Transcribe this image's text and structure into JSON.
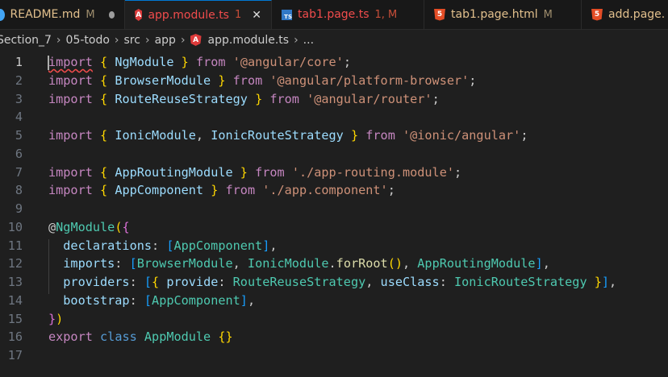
{
  "tabs": [
    {
      "label": "README.md",
      "badge": "M",
      "icon": "markdown-icon",
      "color": "#e2c08d",
      "badge_color": "#9e8d6d",
      "dot": true
    },
    {
      "label": "app.module.ts",
      "badge": "1",
      "icon": "angular-icon",
      "color": "#f14c4c",
      "badge_color": "#c74e39",
      "active": true
    },
    {
      "label": "tab1.page.ts",
      "badge": "1, M",
      "icon": "typescript-icon",
      "color": "#f14c4c",
      "badge_color": "#c74e39",
      "icon_text": "TS"
    },
    {
      "label": "tab1.page.html",
      "badge": "M",
      "icon": "html-icon",
      "color": "#e2c08d",
      "badge_color": "#9e8d6d",
      "icon_text": "5"
    },
    {
      "label": "add.page.",
      "badge": "",
      "icon": "html-icon",
      "color": "#e2c08d",
      "badge_color": "#9e8d6d",
      "icon_text": "5"
    }
  ],
  "breadcrumb": [
    "Section_7",
    "05-todo",
    "src",
    "app",
    "app.module.ts",
    "..."
  ],
  "lines": [
    [
      [
        "import",
        "kw"
      ],
      [
        " ",
        ""
      ],
      [
        "{",
        "br1"
      ],
      [
        " NgModule ",
        "id"
      ],
      [
        "}",
        "br1"
      ],
      [
        " ",
        ""
      ],
      [
        "from",
        "kw"
      ],
      [
        " ",
        ""
      ],
      [
        "'@angular/core'",
        "str"
      ],
      [
        ";",
        "pun"
      ]
    ],
    [
      [
        "import",
        "kw"
      ],
      [
        " ",
        ""
      ],
      [
        "{",
        "br1"
      ],
      [
        " BrowserModule ",
        "id"
      ],
      [
        "}",
        "br1"
      ],
      [
        " ",
        ""
      ],
      [
        "from",
        "kw"
      ],
      [
        " ",
        ""
      ],
      [
        "'@angular/platform-browser'",
        "str"
      ],
      [
        ";",
        "pun"
      ]
    ],
    [
      [
        "import",
        "kw"
      ],
      [
        " ",
        ""
      ],
      [
        "{",
        "br1"
      ],
      [
        " RouteReuseStrategy ",
        "id"
      ],
      [
        "}",
        "br1"
      ],
      [
        " ",
        ""
      ],
      [
        "from",
        "kw"
      ],
      [
        " ",
        ""
      ],
      [
        "'@angular/router'",
        "str"
      ],
      [
        ";",
        "pun"
      ]
    ],
    [],
    [
      [
        "import",
        "kw"
      ],
      [
        " ",
        ""
      ],
      [
        "{",
        "br1"
      ],
      [
        " IonicModule",
        "id"
      ],
      [
        ", ",
        "pun"
      ],
      [
        "IonicRouteStrategy ",
        "id"
      ],
      [
        "}",
        "br1"
      ],
      [
        " ",
        ""
      ],
      [
        "from",
        "kw"
      ],
      [
        " ",
        ""
      ],
      [
        "'@ionic/angular'",
        "str"
      ],
      [
        ";",
        "pun"
      ]
    ],
    [],
    [
      [
        "import",
        "kw"
      ],
      [
        " ",
        ""
      ],
      [
        "{",
        "br1"
      ],
      [
        " AppRoutingModule ",
        "id"
      ],
      [
        "}",
        "br1"
      ],
      [
        " ",
        ""
      ],
      [
        "from",
        "kw"
      ],
      [
        " ",
        ""
      ],
      [
        "'./app-routing.module'",
        "str"
      ],
      [
        ";",
        "pun"
      ]
    ],
    [
      [
        "import",
        "kw"
      ],
      [
        " ",
        ""
      ],
      [
        "{",
        "br1"
      ],
      [
        " AppComponent ",
        "id"
      ],
      [
        "}",
        "br1"
      ],
      [
        " ",
        ""
      ],
      [
        "from",
        "kw"
      ],
      [
        " ",
        ""
      ],
      [
        "'./app.component'",
        "str"
      ],
      [
        ";",
        "pun"
      ]
    ],
    [],
    [
      [
        "@",
        "pun"
      ],
      [
        "NgModule",
        "cls"
      ],
      [
        "(",
        "br1"
      ],
      [
        "{",
        "br2"
      ]
    ],
    [
      [
        "  declarations",
        "id"
      ],
      [
        ": ",
        "pun"
      ],
      [
        "[",
        "br3"
      ],
      [
        "AppComponent",
        "cls"
      ],
      [
        "]",
        "br3"
      ],
      [
        ",",
        "pun"
      ]
    ],
    [
      [
        "  imports",
        "id"
      ],
      [
        ": ",
        "pun"
      ],
      [
        "[",
        "br3"
      ],
      [
        "BrowserModule",
        "cls"
      ],
      [
        ", ",
        "pun"
      ],
      [
        "IonicModule",
        "cls"
      ],
      [
        ".",
        "pun"
      ],
      [
        "forRoot",
        "fn"
      ],
      [
        "()",
        "br1"
      ],
      [
        ", ",
        "pun"
      ],
      [
        "AppRoutingModule",
        "cls"
      ],
      [
        "]",
        "br3"
      ],
      [
        ",",
        "pun"
      ]
    ],
    [
      [
        "  providers",
        "id"
      ],
      [
        ": ",
        "pun"
      ],
      [
        "[",
        "br3"
      ],
      [
        "{",
        "br1"
      ],
      [
        " provide",
        "id"
      ],
      [
        ": ",
        "pun"
      ],
      [
        "RouteReuseStrategy",
        "cls"
      ],
      [
        ", ",
        "pun"
      ],
      [
        "useClass",
        "id"
      ],
      [
        ": ",
        "pun"
      ],
      [
        "IonicRouteStrategy ",
        "cls"
      ],
      [
        "}",
        "br1"
      ],
      [
        "]",
        "br3"
      ],
      [
        ",",
        "pun"
      ]
    ],
    [
      [
        "  bootstrap",
        "id"
      ],
      [
        ": ",
        "pun"
      ],
      [
        "[",
        "br3"
      ],
      [
        "AppComponent",
        "cls"
      ],
      [
        "]",
        "br3"
      ],
      [
        ",",
        "pun"
      ]
    ],
    [
      [
        "}",
        "br2"
      ],
      [
        ")",
        "br1"
      ]
    ],
    [
      [
        "export",
        "kw"
      ],
      [
        " ",
        ""
      ],
      [
        "class",
        "kw2"
      ],
      [
        " ",
        ""
      ],
      [
        "AppModule",
        "cls"
      ],
      [
        " ",
        ""
      ],
      [
        "{}",
        "br1"
      ]
    ],
    []
  ],
  "current_line": 1
}
